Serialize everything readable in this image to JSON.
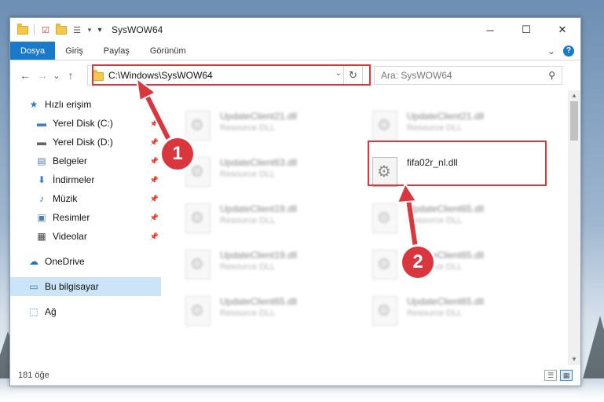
{
  "window": {
    "title": "SysWOW64",
    "controls": {
      "minimize": "─",
      "maximize": "☐",
      "close": "✕"
    }
  },
  "quick_access": {
    "dropdown": "▾",
    "customize": "▾"
  },
  "ribbon": {
    "tabs": [
      "Dosya",
      "Giriş",
      "Paylaş",
      "Görünüm"
    ],
    "collapse": "⌄",
    "help": "?"
  },
  "nav": {
    "back": "←",
    "forward": "→",
    "recent": "⌄",
    "up": "↑"
  },
  "address": {
    "path": "C:\\Windows\\SysWOW64",
    "dropdown": "⌄",
    "refresh": "↻"
  },
  "search": {
    "placeholder": "Ara: SysWOW64",
    "icon": "search-icon"
  },
  "sidebar": {
    "items": [
      {
        "label": "Hızlı erişim",
        "icon": "star-icon",
        "glyph": "★",
        "color": "#2d7bd6",
        "level": 0
      },
      {
        "label": "Yerel Disk (C:)",
        "icon": "windows-drive-icon",
        "glyph": "▬",
        "color": "#3e7fc6",
        "level": 1,
        "pinned": true
      },
      {
        "label": "Yerel Disk (D:)",
        "icon": "drive-icon",
        "glyph": "▬",
        "color": "#666666",
        "level": 1,
        "pinned": true
      },
      {
        "label": "Belgeler",
        "icon": "documents-icon",
        "glyph": "▤",
        "color": "#5a7fb0",
        "level": 1,
        "pinned": true
      },
      {
        "label": "İndirmeler",
        "icon": "download-icon",
        "glyph": "⬇",
        "color": "#2e7dd6",
        "level": 1,
        "pinned": true
      },
      {
        "label": "Müzik",
        "icon": "music-icon",
        "glyph": "♪",
        "color": "#2e7dd6",
        "level": 1,
        "pinned": true
      },
      {
        "label": "Resimler",
        "icon": "pictures-icon",
        "glyph": "▣",
        "color": "#4f7fae",
        "level": 1,
        "pinned": true
      },
      {
        "label": "Videolar",
        "icon": "videos-icon",
        "glyph": "▦",
        "color": "#444444",
        "level": 1,
        "pinned": true
      },
      {
        "label": "OneDrive",
        "icon": "onedrive-icon",
        "glyph": "☁",
        "color": "#1d6fc9",
        "level": 0,
        "gap": true
      },
      {
        "label": "Bu bilgisayar",
        "icon": "computer-icon",
        "glyph": "▭",
        "color": "#2a7ed1",
        "level": 0,
        "gap": true,
        "selected": true
      },
      {
        "label": "Ağ",
        "icon": "network-icon",
        "glyph": "⬚",
        "color": "#2a7ed1",
        "level": 0,
        "gap": true
      }
    ],
    "pin_glyph": "📌"
  },
  "files": [
    {
      "name": "UpdateClient21.dll",
      "type": "Resource DLL",
      "col": 0,
      "row": 0,
      "blurred": true
    },
    {
      "name": "UpdateClient21.dll",
      "type": "Resource DLL",
      "col": 1,
      "row": 0,
      "blurred": true
    },
    {
      "name": "UpdateClient63.dll",
      "type": "Resource DLL",
      "col": 0,
      "row": 1,
      "blurred": true
    },
    {
      "name": "fifa02r_nl.dll",
      "type": "",
      "col": 1,
      "row": 1,
      "blurred": false
    },
    {
      "name": "UpdateClient19.dll",
      "type": "Resource DLL",
      "col": 0,
      "row": 2,
      "blurred": true
    },
    {
      "name": "UpdateClient65.dll",
      "type": "Resource DLL",
      "col": 1,
      "row": 2,
      "blurred": true
    },
    {
      "name": "UpdateClient19.dll",
      "type": "Resource DLL",
      "col": 0,
      "row": 3,
      "blurred": true
    },
    {
      "name": "UpdateClient65.dll",
      "type": "Resource DLL",
      "col": 1,
      "row": 3,
      "blurred": true
    },
    {
      "name": "UpdateClient65.dll",
      "type": "Resource DLL",
      "col": 0,
      "row": 4,
      "blurred": true
    },
    {
      "name": "UpdateClient65.dll",
      "type": "Resource DLL",
      "col": 1,
      "row": 4,
      "blurred": true
    }
  ],
  "status": {
    "count": "181 öğe"
  },
  "annotations": {
    "step1": "1",
    "step2": "2",
    "highlight_color": "#d9363e"
  }
}
